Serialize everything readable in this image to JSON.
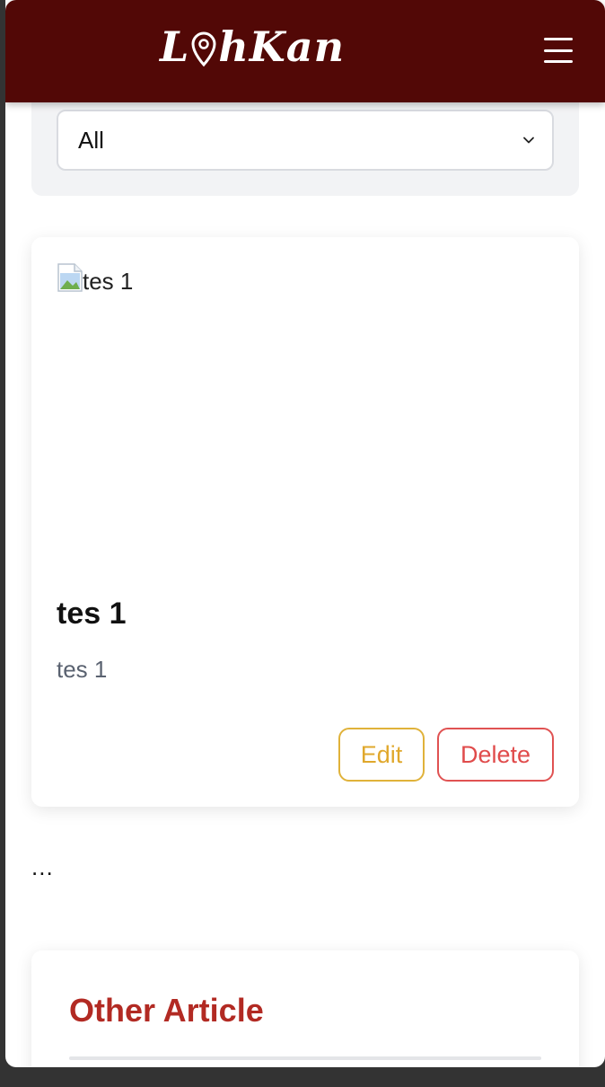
{
  "navbar": {
    "logo_text_start": "L",
    "logo_text_end": "hKan",
    "brand_color": "#520806",
    "menu_icon": "hamburger-menu-icon"
  },
  "filter": {
    "selected_value": "All",
    "icon": "chevron-down-icon"
  },
  "article": {
    "image_alt": "tes 1",
    "title": "tes 1",
    "description": "tes 1",
    "edit_label": "Edit",
    "delete_label": "Delete",
    "edit_color": "#e0a82c",
    "delete_color": "#e04b4b"
  },
  "pagination": {
    "ellipsis": "..."
  },
  "other_articles": {
    "heading": "Other Article",
    "heading_color": "#b22a23"
  }
}
